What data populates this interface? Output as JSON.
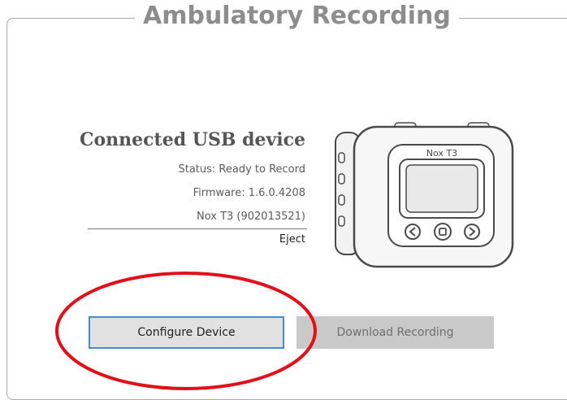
{
  "group": {
    "title": "Ambulatory Recording"
  },
  "device": {
    "heading": "Connected USB device",
    "status": "Status: Ready to Record",
    "firmware": "Firmware: 1.6.0.4208",
    "name": "Nox T3 (902013521)",
    "eject_label": "Eject",
    "screen_label": "Nox T3"
  },
  "buttons": {
    "configure_label": "Configure Device",
    "download_label": "Download Recording"
  },
  "icons": {
    "device_image": "nox-t3-device-icon",
    "highlight": "red-ellipse-annotation"
  },
  "colors": {
    "title_gray": "#8d8d8d",
    "focus_blue": "#3f8fd8",
    "highlight_red": "#e3101a",
    "disabled_button": "#c9c9c9"
  }
}
